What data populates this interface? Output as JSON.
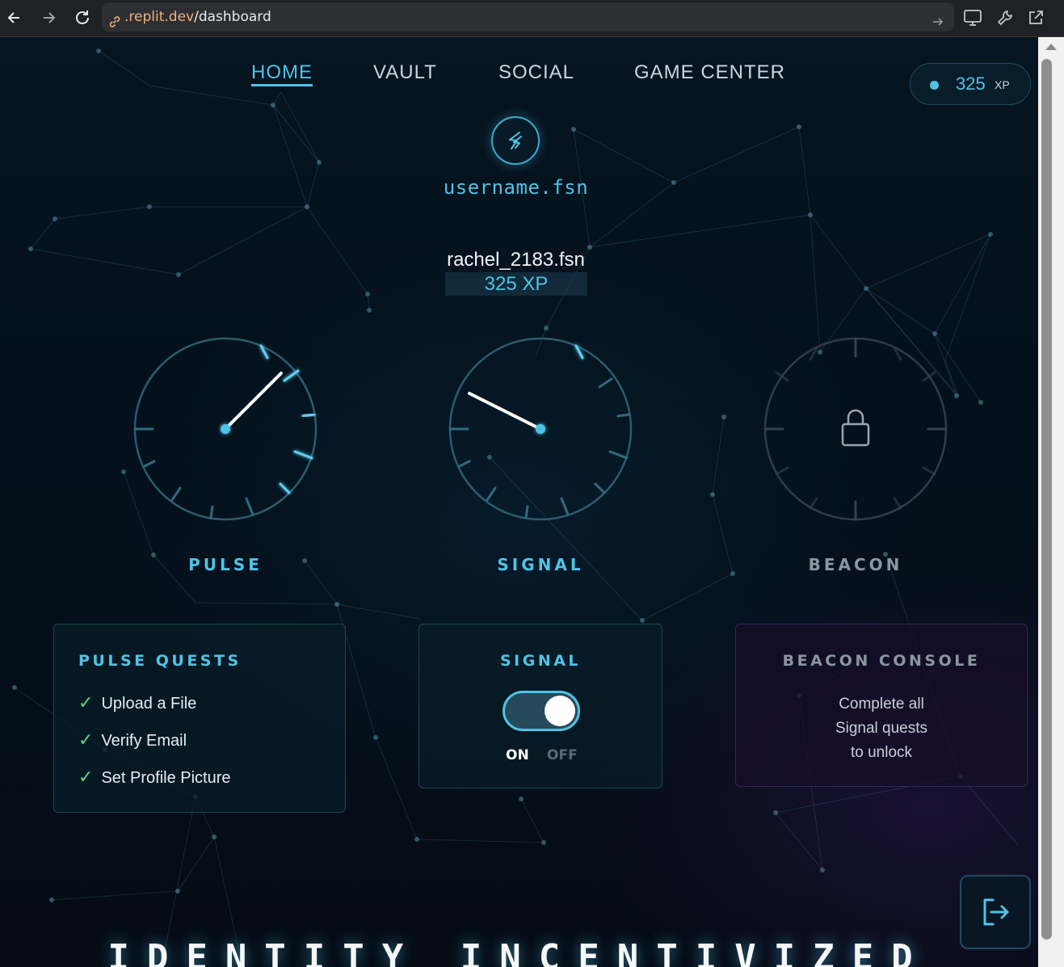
{
  "browser": {
    "url_domain": ".replit.dev",
    "url_path": "/dashboard"
  },
  "nav": {
    "items": [
      {
        "label": "HOME",
        "active": true
      },
      {
        "label": "VAULT",
        "active": false
      },
      {
        "label": "SOCIAL",
        "active": false
      },
      {
        "label": "GAME CENTER",
        "active": false
      }
    ]
  },
  "xp_badge": {
    "value": "325",
    "unit": "XP"
  },
  "brand": {
    "name": "username.fsn",
    "logo_icon": "lightning-swirl-icon"
  },
  "user": {
    "name": "rachel_2183.fsn",
    "xp": "325 XP"
  },
  "gauges": [
    {
      "label": "PULSE",
      "state": "active",
      "color": "#4fc3e6"
    },
    {
      "label": "SIGNAL",
      "state": "active",
      "color": "#4fc3e6"
    },
    {
      "label": "BEACON",
      "state": "locked",
      "icon": "lock-icon",
      "color": "#8a96a2"
    }
  ],
  "pulse_card": {
    "title": "PULSE QUESTS",
    "quests": [
      {
        "label": "Upload a File",
        "done": true
      },
      {
        "label": "Verify Email",
        "done": true
      },
      {
        "label": "Set Profile Picture",
        "done": true
      }
    ]
  },
  "signal_card": {
    "title": "SIGNAL",
    "toggle_on_label": "ON",
    "toggle_off_label": "OFF",
    "toggle_state": "on"
  },
  "beacon_card": {
    "title": "BEACON CONSOLE",
    "message_lines": [
      "Complete all",
      "Signal quests",
      "to unlock"
    ]
  },
  "footer": {
    "tagline": "IDENTITY INCENTIVIZED",
    "logout_icon": "logout-icon"
  },
  "colors": {
    "accent": "#4fc3e6",
    "check": "#5fd38a",
    "background": "#05101a"
  }
}
